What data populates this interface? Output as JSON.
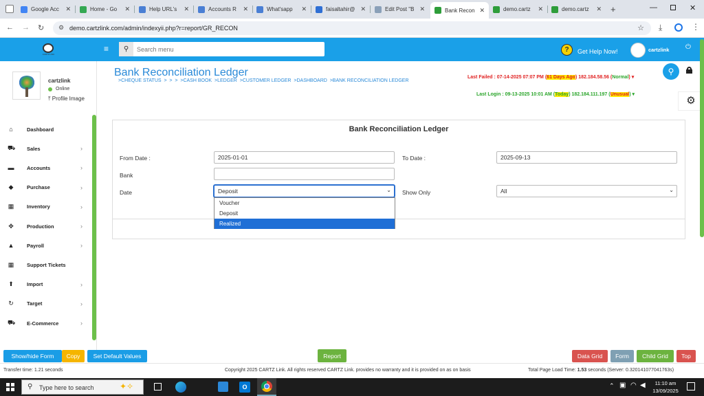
{
  "browser": {
    "tabs": [
      {
        "title": "Google Acc",
        "color": "#4285f4"
      },
      {
        "title": "Home - Go",
        "color": "#34a853"
      },
      {
        "title": "Help URL's",
        "color": "#4a7fd4"
      },
      {
        "title": "Accounts R",
        "color": "#4a7fd4"
      },
      {
        "title": "What'sapp",
        "color": "#4a7fd4"
      },
      {
        "title": "faisaltahir@",
        "color": "#2f6fd4"
      },
      {
        "title": "Edit Post \"B",
        "color": "#8aa0b8"
      },
      {
        "title": "Bank Recon",
        "color": "#2e9d3a"
      },
      {
        "title": "demo.cartz",
        "color": "#2e9d3a"
      },
      {
        "title": "demo.cartz",
        "color": "#2e9d3a"
      }
    ],
    "url": "demo.cartzlink.com/admin/indexyii.php?r=report/GR_RECON",
    "icons": [
      "back-icon",
      "forward-icon",
      "reload-icon",
      "site-settings-icon",
      "star-icon",
      "download-icon",
      "profile-icon",
      "more-icon"
    ]
  },
  "header": {
    "search_placeholder": "Search menu",
    "help_label": "Get Help Now!",
    "user_name": "cartzlink",
    "logo_text": "CARTZ LINK"
  },
  "profile": {
    "name": "cartzlink",
    "status": "Online",
    "image_link": "Profile Image"
  },
  "page": {
    "title": "Bank Reconciliation Ledger",
    "breadcrumb": ">CHEQUE STATUS  >  >  >  >CASH BOOK  >LEDGER  >CUSTOMER LEDGER  >DASHBOARD  >BANK RECONCILIATION LEDGER",
    "last_failed_prefix": "Last Failed : 07-14-2025 07:07 PM (",
    "last_failed_ago": "61 Days Ago",
    "last_failed_ip": ") 182.184.58.56 (",
    "last_failed_status": "Normal",
    "last_failed_end": ")",
    "last_login_prefix": "Last Login : 09-13-2025 10:01 AM (",
    "last_login_ago": "Today",
    "last_login_ip": ") 182.184.111.197 (",
    "last_login_status": "Unusual",
    "last_login_end": ")"
  },
  "sidebar": {
    "items": [
      {
        "label": "Dashboard",
        "icon": "home-icon",
        "glyph": "⌂",
        "chevron": false
      },
      {
        "label": "Sales",
        "icon": "cart-icon",
        "glyph": "⛟",
        "chevron": true
      },
      {
        "label": "Accounts",
        "icon": "briefcase-icon",
        "glyph": "▬",
        "chevron": true
      },
      {
        "label": "Purchase",
        "icon": "tag-icon",
        "glyph": "◆",
        "chevron": true
      },
      {
        "label": "Inventory",
        "icon": "grid-icon",
        "glyph": "▦",
        "chevron": true
      },
      {
        "label": "Production",
        "icon": "cube-icon",
        "glyph": "✥",
        "chevron": true
      },
      {
        "label": "Payroll",
        "icon": "bank-icon",
        "glyph": "▲",
        "chevron": true
      },
      {
        "label": "Support Tickets",
        "icon": "apps-icon",
        "glyph": "▦",
        "chevron": false
      },
      {
        "label": "Import",
        "icon": "upload-icon",
        "glyph": "⬆",
        "chevron": true
      },
      {
        "label": "Target",
        "icon": "refresh-icon",
        "glyph": "↻",
        "chevron": true
      },
      {
        "label": "E-Commerce",
        "icon": "cart-icon",
        "glyph": "⛟",
        "chevron": true
      }
    ]
  },
  "form": {
    "panel_title": "Bank Reconciliation Ledger",
    "from_date_label": "From Date :",
    "from_date_value": "2025-01-01",
    "to_date_label": "To Date :",
    "to_date_value": "2025-09-13",
    "bank_label": "Bank",
    "bank_value": "",
    "date_label": "Date",
    "date_selected": "Deposit",
    "date_options": [
      "Voucher",
      "Deposit",
      "Realized"
    ],
    "date_highlighted": "Realized",
    "show_only_label": "Show Only",
    "show_only_selected": "All"
  },
  "footer": {
    "buttons_left": [
      {
        "label": "Show/hide Form",
        "color": "#1a9de6"
      },
      {
        "label": "Copy",
        "color": "#f5b500"
      },
      {
        "label": "Set Default Values",
        "color": "#1a9de6"
      }
    ],
    "report_button": "Report",
    "buttons_right": [
      {
        "label": "Data Grid",
        "color": "#d9534f"
      },
      {
        "label": "Form",
        "color": "#7fa0b3"
      },
      {
        "label": "Child Grid",
        "color": "#6cb33f"
      },
      {
        "label": "Top",
        "color": "#d9534f"
      }
    ],
    "transfer_time": "Transfer time: 1.21 seconds",
    "copyright": "Copyright 2025 CARTZ Link. All rights reserved CARTZ Link. provides no warranty and it is provided on as on basis",
    "load_time_prefix": "Total Page Load Time: ",
    "load_time_value": "1.53",
    "load_time_suffix": " seconds (Server: 0.320141077041763s)"
  },
  "taskbar": {
    "search_placeholder": "Type here to search",
    "time": "11:10 am",
    "date": "13/09/2025"
  }
}
